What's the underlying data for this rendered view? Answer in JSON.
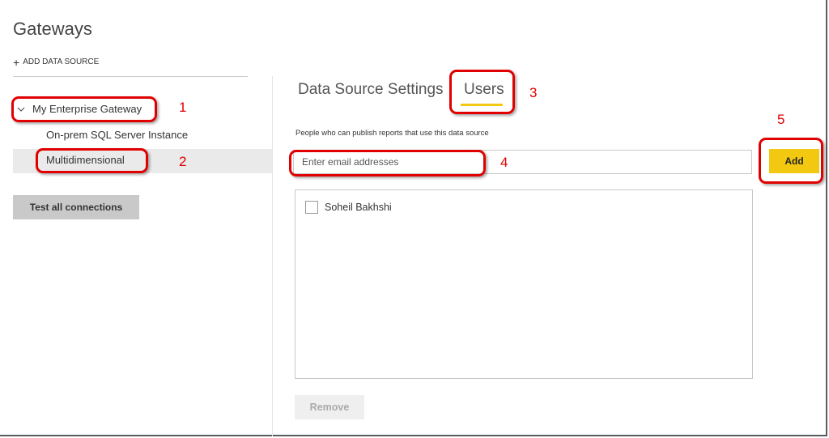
{
  "page": {
    "title": "Gateways"
  },
  "sidebar": {
    "add_data_source_label": "ADD DATA SOURCE",
    "gateway": {
      "label": "My Enterprise Gateway",
      "expanded": true
    },
    "data_sources": [
      {
        "label": "On-prem SQL Server Instance",
        "selected": false
      },
      {
        "label": "Multidimensional",
        "selected": true
      }
    ],
    "test_button_label": "Test all connections"
  },
  "main": {
    "tabs": [
      {
        "label": "Data Source Settings",
        "active": false
      },
      {
        "label": "Users",
        "active": true
      }
    ],
    "help_text": "People who can publish reports that use this data source",
    "email_input": {
      "placeholder": "Enter email addresses",
      "value": ""
    },
    "add_button_label": "Add",
    "users": [
      {
        "name": "Soheil Bakhshi",
        "checked": false
      }
    ],
    "remove_button_label": "Remove"
  },
  "annotations": [
    {
      "number": "1",
      "target": "gateway"
    },
    {
      "number": "2",
      "target": "data-source-multidimensional"
    },
    {
      "number": "3",
      "target": "tab-users"
    },
    {
      "number": "4",
      "target": "email-input"
    },
    {
      "number": "5",
      "target": "add-button"
    }
  ],
  "colors": {
    "accent": "#f2c811",
    "callout": "#e00000",
    "selected_bg": "#eaeaea",
    "button_gray": "#c9c9c9"
  }
}
